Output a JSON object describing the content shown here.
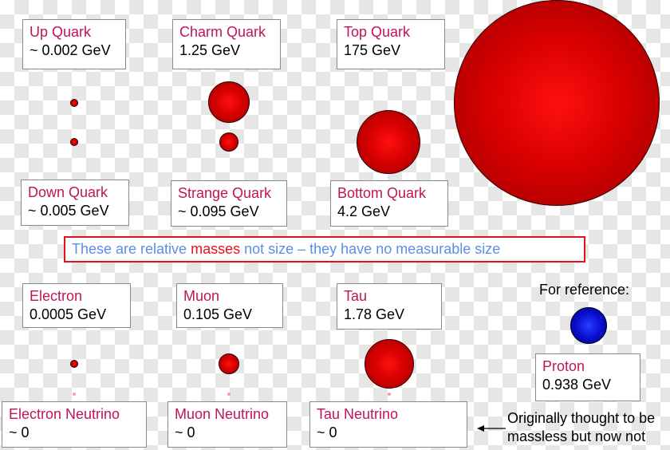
{
  "quarks": [
    {
      "name": "Up Quark",
      "mass": "~ 0.002 GeV"
    },
    {
      "name": "Charm Quark",
      "mass": "1.25 GeV"
    },
    {
      "name": "Top Quark",
      "mass": "175 GeV"
    },
    {
      "name": "Down Quark",
      "mass": "~ 0.005 GeV"
    },
    {
      "name": "Strange Quark",
      "mass": "~ 0.095 GeV"
    },
    {
      "name": "Bottom Quark",
      "mass": "4.2 GeV"
    }
  ],
  "note": {
    "part1": "These are relative ",
    "part2": "masses",
    "part3": " not size – they have no measurable size"
  },
  "leptons": [
    {
      "name": "Electron",
      "mass": "0.0005 GeV"
    },
    {
      "name": "Muon",
      "mass": "0.105 GeV"
    },
    {
      "name": "Tau",
      "mass": "1.78 GeV"
    },
    {
      "name": "Electron Neutrino",
      "mass": "~ 0"
    },
    {
      "name": "Muon Neutrino",
      "mass": "~ 0"
    },
    {
      "name": "Tau Neutrino",
      "mass": "~ 0"
    }
  ],
  "reference": {
    "heading": "For reference:",
    "name": "Proton",
    "mass": "0.938 GeV"
  },
  "neutrino_note": {
    "line1": "Originally thought to be",
    "line2": "massless but now not"
  },
  "colors": {
    "particle_name": "#c0145a",
    "note_text": "#5b8ee6",
    "note_highlight": "#e3121b",
    "particle_fill": "#e00000",
    "proton_fill": "#0a0fd0"
  }
}
